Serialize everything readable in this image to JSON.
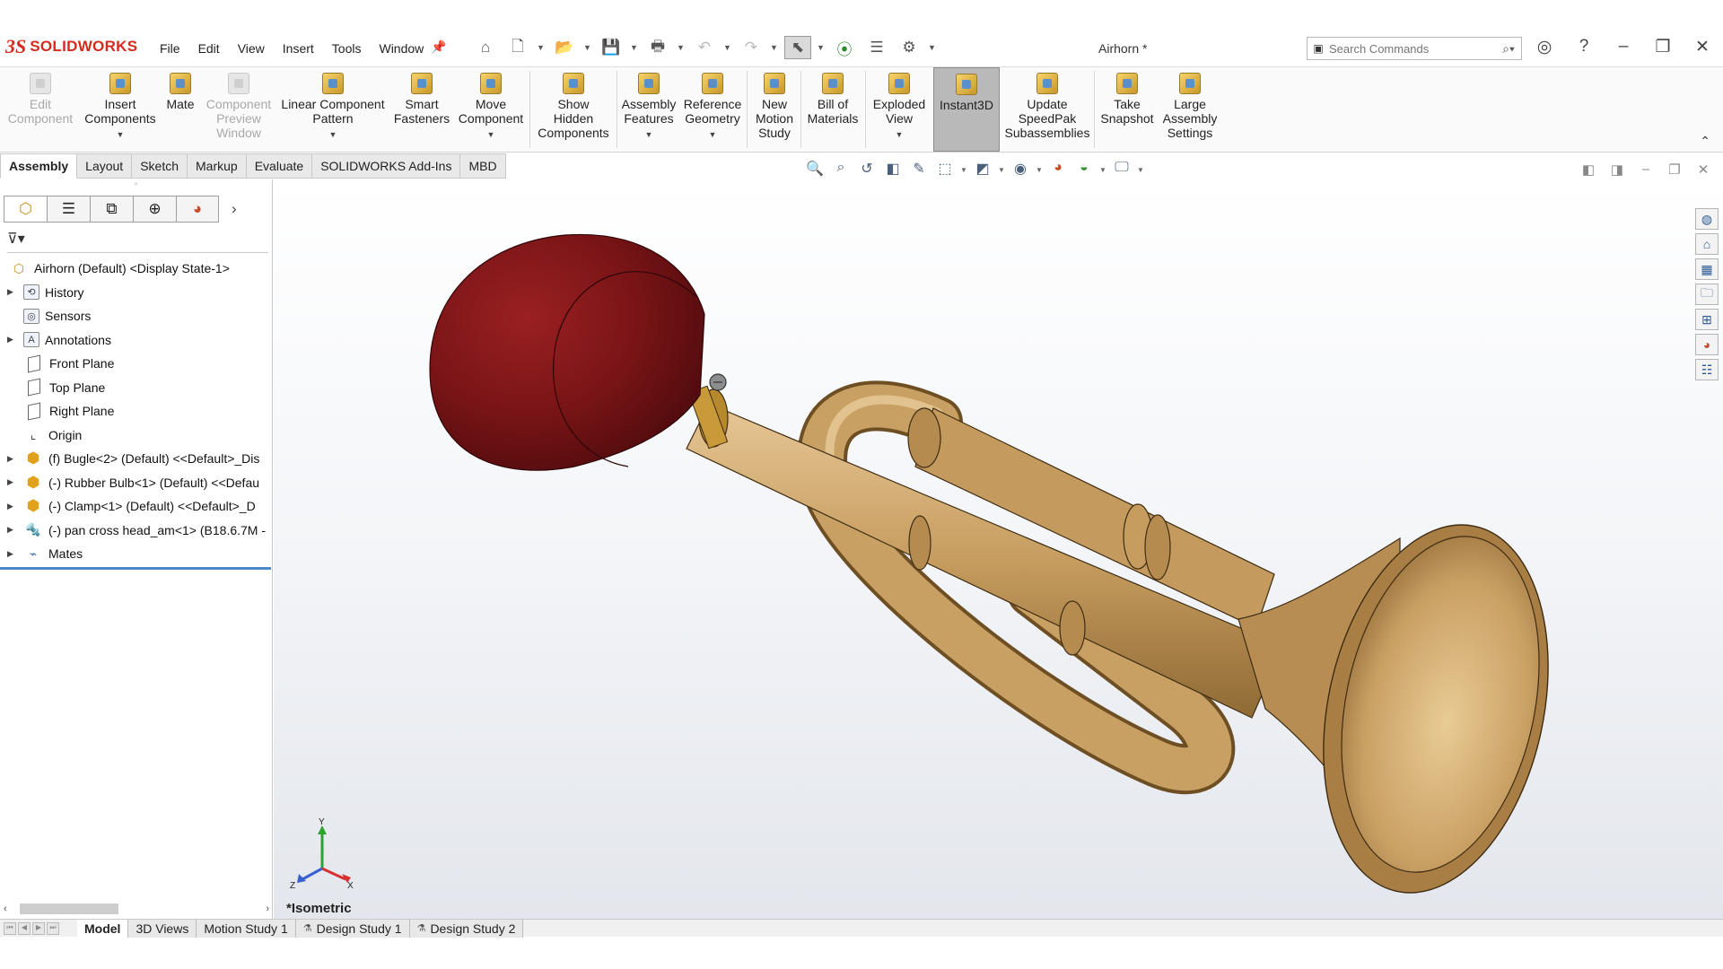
{
  "app": {
    "logo_ds": "3S",
    "logo_text": "SOLIDWORKS",
    "document_title": "Airhorn *"
  },
  "menu": [
    "File",
    "Edit",
    "View",
    "Insert",
    "Tools",
    "Window"
  ],
  "search": {
    "placeholder": "Search Commands"
  },
  "command_manager": {
    "edit_component": "Edit\nComponent",
    "insert_components": "Insert\nComponents",
    "mate": "Mate",
    "component_preview": "Component\nPreview\nWindow",
    "linear_pattern": "Linear Component\nPattern",
    "smart_fasteners": "Smart\nFasteners",
    "move_component": "Move\nComponent",
    "show_hidden": "Show\nHidden\nComponents",
    "assembly_features": "Assembly\nFeatures",
    "reference_geometry": "Reference\nGeometry",
    "new_motion_study": "New\nMotion\nStudy",
    "bill_of_materials": "Bill of\nMaterials",
    "exploded_view": "Exploded\nView",
    "instant3d": "Instant3D",
    "update_speedpak": "Update\nSpeedPak\nSubassemblies",
    "take_snapshot": "Take\nSnapshot",
    "large_assembly": "Large\nAssembly\nSettings"
  },
  "tabs": {
    "assembly": "Assembly",
    "layout": "Layout",
    "sketch": "Sketch",
    "markup": "Markup",
    "evaluate": "Evaluate",
    "addins": "SOLIDWORKS Add-Ins",
    "mbd": "MBD"
  },
  "tree": {
    "root": "Airhorn (Default) <Display State-1>",
    "history": "History",
    "sensors": "Sensors",
    "annotations": "Annotations",
    "front_plane": "Front Plane",
    "top_plane": "Top Plane",
    "right_plane": "Right Plane",
    "origin": "Origin",
    "bugle": "(f) Bugle<2> (Default) <<Default>_Dis",
    "rubber_bulb": "(-) Rubber Bulb<1> (Default) <<Defau",
    "clamp": "(-) Clamp<1> (Default) <<Default>_D",
    "screw": "(-) pan cross head_am<1> (B18.6.7M - ",
    "mates": "Mates"
  },
  "viewport": {
    "view_label": "*Isometric",
    "triad": {
      "x": "X",
      "y": "Y",
      "z": "Z"
    }
  },
  "bottom_tabs": {
    "model": "Model",
    "views_3d": "3D Views",
    "motion_study": "Motion Study 1",
    "design_study_1": "Design Study 1",
    "design_study_2": "Design Study 2"
  },
  "colors": {
    "brand": "#d52b1e",
    "brass": "#c9a064",
    "rubber": "#7a1416",
    "selected_line": "#4a89c8"
  }
}
